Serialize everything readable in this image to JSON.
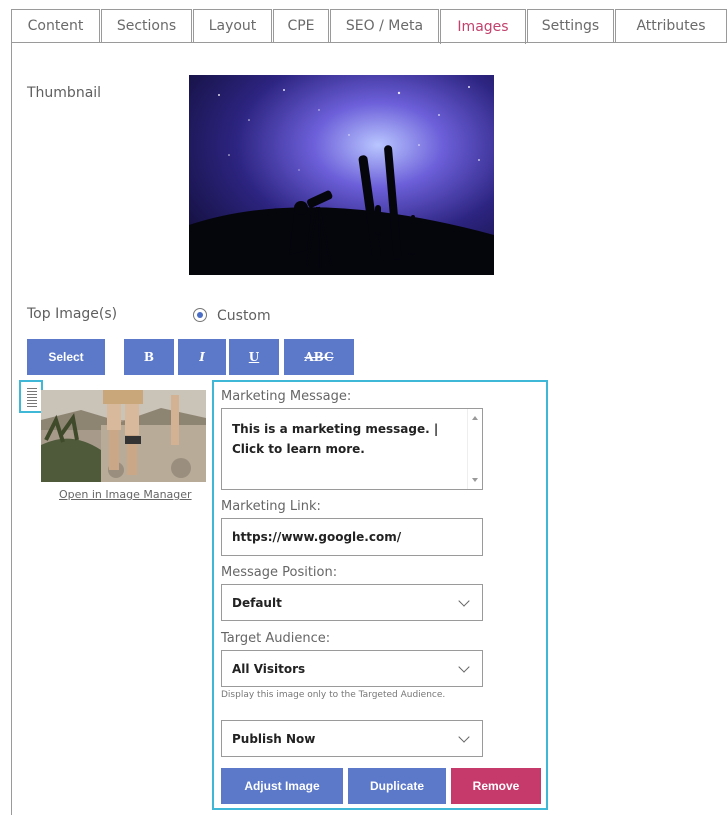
{
  "tabs": [
    {
      "label": "Content"
    },
    {
      "label": "Sections"
    },
    {
      "label": "Layout"
    },
    {
      "label": "CPE"
    },
    {
      "label": "SEO / Meta"
    },
    {
      "label": "Images",
      "active": true
    },
    {
      "label": "Settings"
    },
    {
      "label": "Attributes"
    }
  ],
  "thumbnail": {
    "label": "Thumbnail"
  },
  "top_images": {
    "label": "Top Image(s)",
    "radio_label": "Custom",
    "selected": true
  },
  "toolbar": {
    "select_label": "Select",
    "bold": "B",
    "italic": "I",
    "underline": "U",
    "strike": "ABC"
  },
  "image_item": {
    "open_link": "Open in Image Manager"
  },
  "form": {
    "marketing_message_label": "Marketing Message:",
    "marketing_message_value": "This is a marketing message. | Click to learn more.",
    "marketing_link_label": "Marketing Link:",
    "marketing_link_value": "https://www.google.com/",
    "message_position_label": "Message Position:",
    "message_position_value": "Default",
    "target_audience_label": "Target Audience:",
    "target_audience_value": "All Visitors",
    "target_audience_hint": "Display this image only to the Targeted Audience.",
    "publish_value": "Publish Now"
  },
  "actions": {
    "adjust": "Adjust Image",
    "duplicate": "Duplicate",
    "remove": "Remove"
  },
  "colors": {
    "accent": "#5b78c9",
    "danger": "#c53a6b",
    "active_tab": "#c2416d",
    "focus": "#3eb8d6"
  }
}
